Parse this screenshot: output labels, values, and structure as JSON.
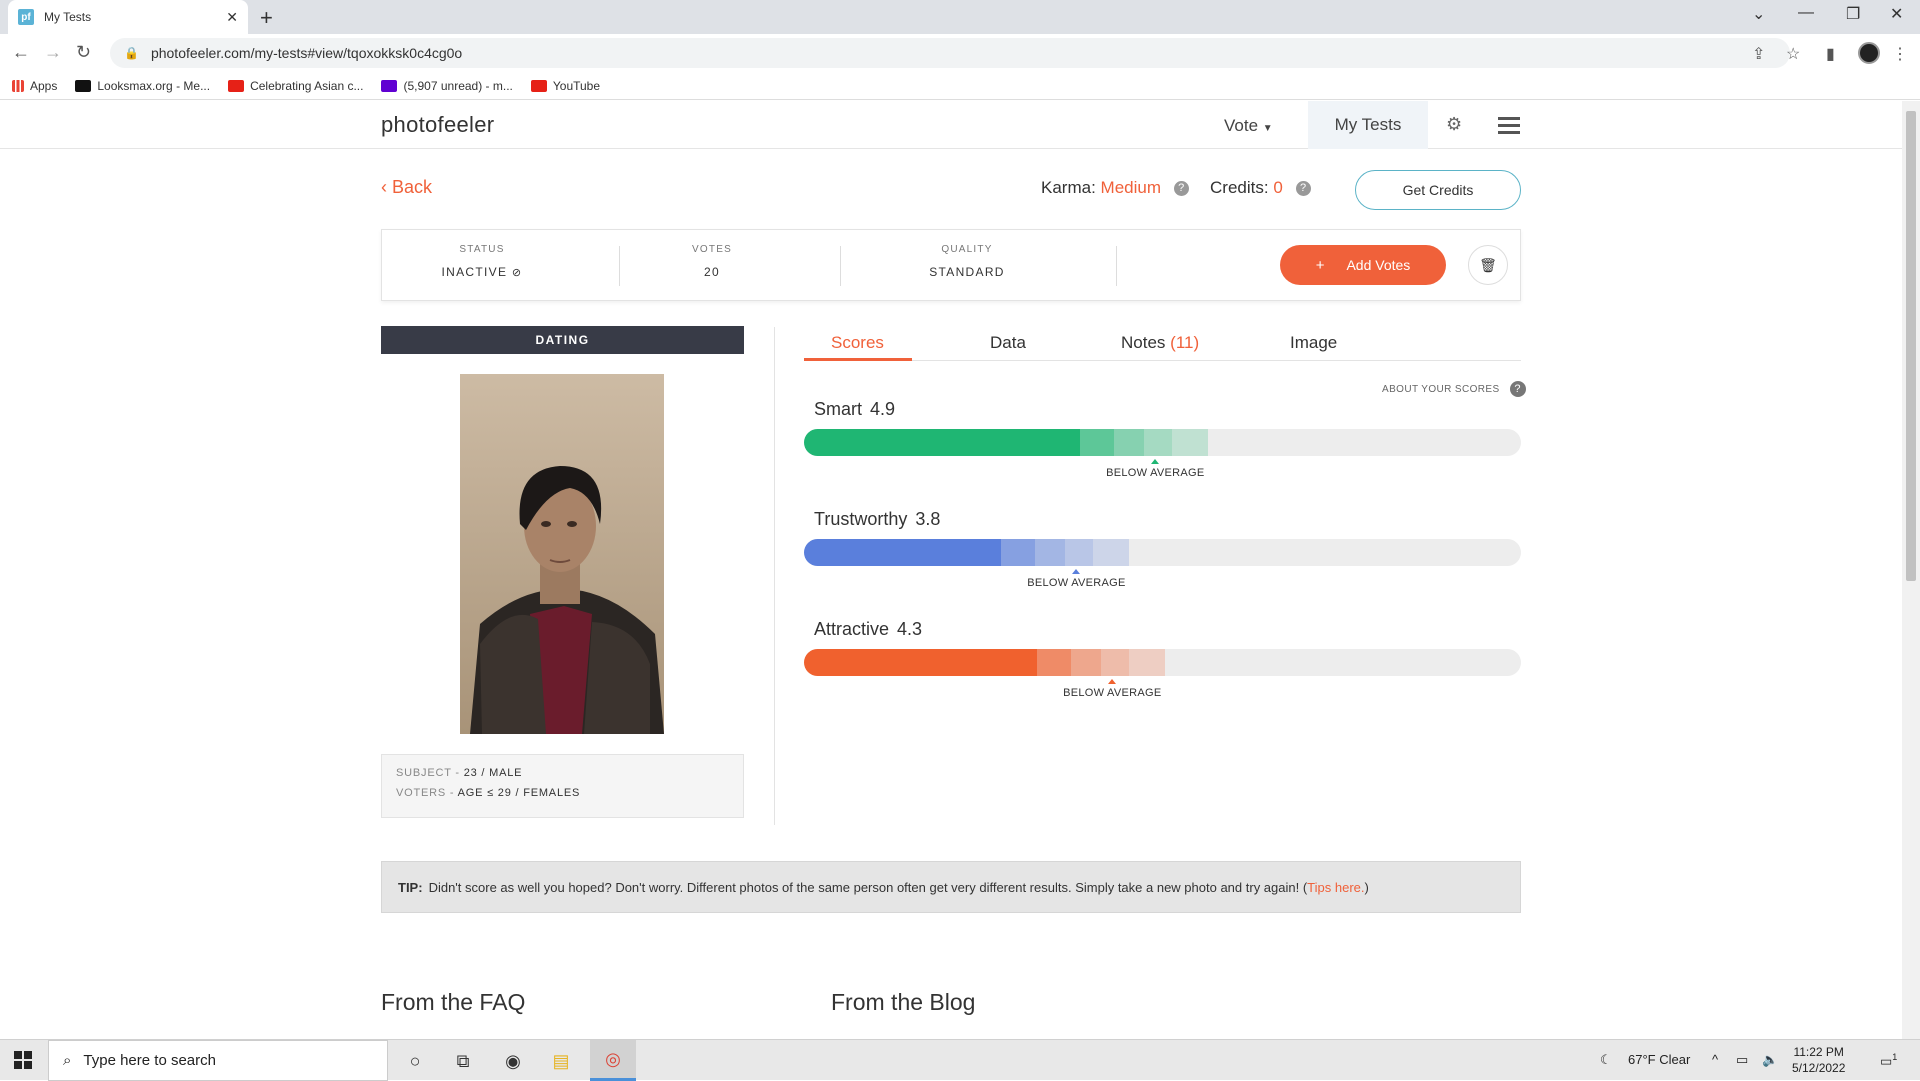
{
  "browser": {
    "tab_title": "My Tests",
    "favicon_text": "pf",
    "url": "photofeeler.com/my-tests#view/tqoxokksk0c4cg0o",
    "bookmarks": [
      {
        "label": "Apps",
        "color": "#4285f4"
      },
      {
        "label": "Looksmax.org - Me...",
        "color": "#111111"
      },
      {
        "label": "Celebrating Asian c...",
        "color": "#e62117"
      },
      {
        "label": "(5,907 unread) - m...",
        "color": "#6001d2"
      },
      {
        "label": "YouTube",
        "color": "#e62117"
      }
    ]
  },
  "site": {
    "logo": "photofeeler",
    "nav_vote": "Vote",
    "nav_my_tests": "My Tests"
  },
  "header": {
    "back_label": "Back",
    "karma_label": "Karma:",
    "karma_value": "Medium",
    "credits_label": "Credits:",
    "credits_value": "0",
    "get_credits_label": "Get Credits"
  },
  "status_panel": {
    "status_label": "STATUS",
    "status_value": "INACTIVE",
    "votes_label": "VOTES",
    "votes_value": "20",
    "quality_label": "QUALITY",
    "quality_value": "STANDARD",
    "add_votes_label": "Add Votes"
  },
  "test": {
    "category": "DATING",
    "subject_label": "SUBJECT",
    "subject_value": "23 / MALE",
    "voters_label": "VOTERS",
    "voters_value": "AGE ≤ 29 / FEMALES"
  },
  "tabs": [
    {
      "label": "Scores"
    },
    {
      "label": "Data"
    },
    {
      "label": "Notes",
      "count": "(11)"
    },
    {
      "label": "Image"
    }
  ],
  "about_scores": "ABOUT YOUR SCORES",
  "scores": [
    {
      "name": "Smart",
      "value": "4.9",
      "note": "BELOW AVERAGE",
      "fraction": 0.49,
      "color": "#1fb673"
    },
    {
      "name": "Trustworthy",
      "value": "3.8",
      "note": "BELOW AVERAGE",
      "fraction": 0.38,
      "color": "#5a7fdc"
    },
    {
      "name": "Attractive",
      "value": "4.3",
      "note": "BELOW AVERAGE",
      "fraction": 0.43,
      "color": "#f0612e"
    }
  ],
  "tip": {
    "label": "TIP:",
    "text": "Didn't score as well you hoped? Don't worry. Different photos of the same person often get very different results. Simply take a new photo and try again! (",
    "link": "Tips here.",
    "tail": ")"
  },
  "sections": {
    "faq": "From the FAQ",
    "blog": "From the Blog"
  },
  "taskbar": {
    "search_placeholder": "Type here to search",
    "weather": "67°F  Clear",
    "time": "11:22 PM",
    "date": "5/12/2022",
    "notifications": "1"
  }
}
